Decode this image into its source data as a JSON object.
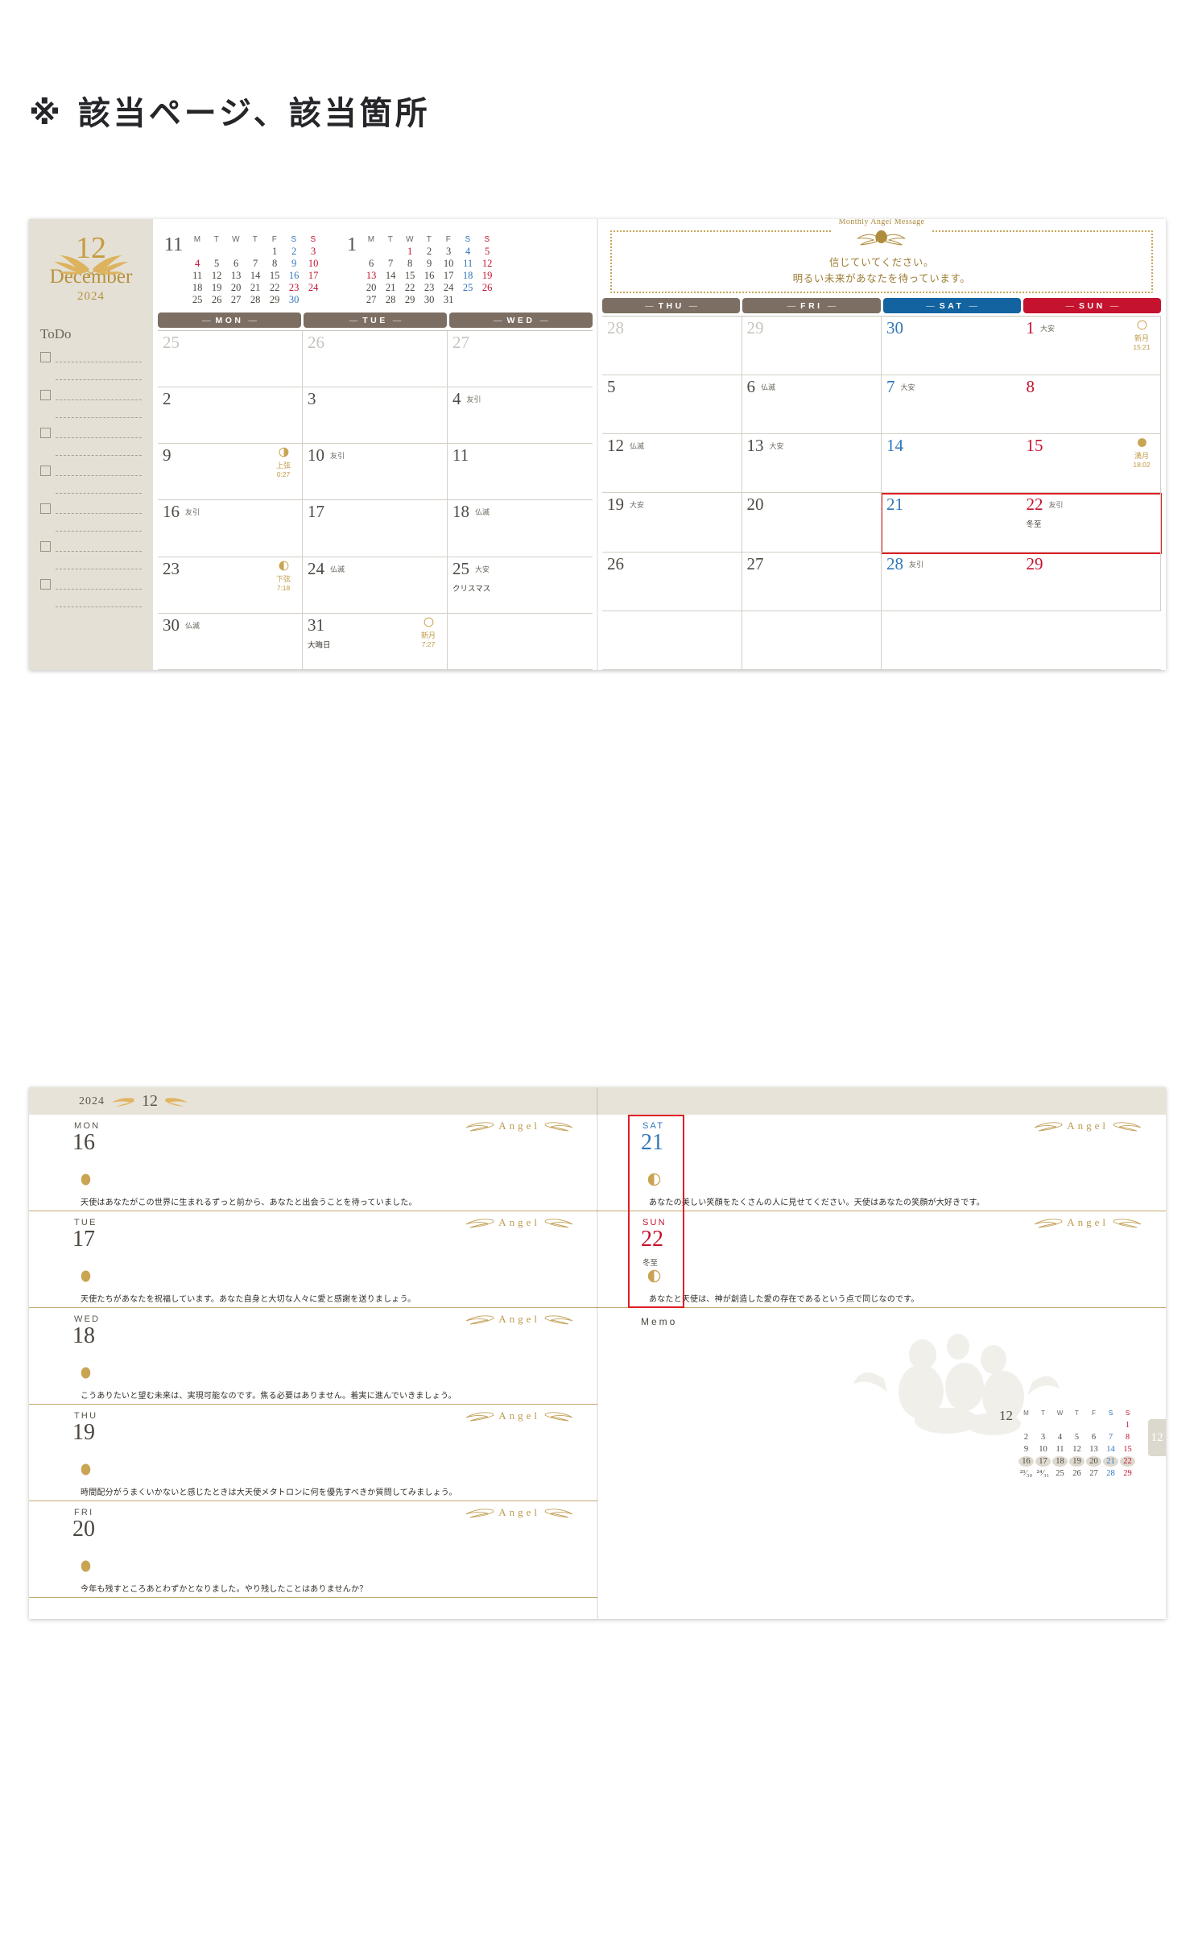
{
  "heading": "※ 該当ページ、該当箇所",
  "monthly": {
    "badge": {
      "month_number": "12",
      "month_name": "December",
      "year": "2024"
    },
    "todo_label": "ToDo",
    "todo_rows": 7,
    "mini_calendars": [
      {
        "label": "11",
        "weekdays": [
          "M",
          "T",
          "W",
          "T",
          "F",
          "S",
          "S"
        ],
        "weeks": [
          [
            "",
            "",
            "",
            "",
            "1",
            "2",
            "3"
          ],
          [
            "4",
            "5",
            "6",
            "7",
            "8",
            "9",
            "10"
          ],
          [
            "11",
            "12",
            "13",
            "14",
            "15",
            "16",
            "17"
          ],
          [
            "18",
            "19",
            "20",
            "21",
            "22",
            "23",
            "24"
          ],
          [
            "25",
            "26",
            "27",
            "28",
            "29",
            "30",
            ""
          ]
        ],
        "holidays": [
          "4",
          "23",
          "24"
        ]
      },
      {
        "label": "1",
        "weekdays": [
          "M",
          "T",
          "W",
          "T",
          "F",
          "S",
          "S"
        ],
        "weeks": [
          [
            "",
            "",
            "1",
            "2",
            "3",
            "4",
            "5"
          ],
          [
            "6",
            "7",
            "8",
            "9",
            "10",
            "11",
            "12"
          ],
          [
            "13",
            "14",
            "15",
            "16",
            "17",
            "18",
            "19"
          ],
          [
            "20",
            "21",
            "22",
            "23",
            "24",
            "25",
            "26"
          ],
          [
            "27",
            "28",
            "29",
            "30",
            "31",
            "",
            ""
          ]
        ],
        "holidays": [
          "1",
          "13"
        ]
      }
    ],
    "day_headers_left": [
      "MON",
      "TUE",
      "WED"
    ],
    "day_headers_right": [
      "THU",
      "FRI",
      "SAT",
      "SUN"
    ],
    "angel_message": {
      "title": "Monthly Angel Message",
      "line1": "信じていてください。",
      "line2": "明るい未来があなたを待っています。"
    },
    "cells_left": [
      {
        "num": "25",
        "prev": true
      },
      {
        "num": "26",
        "prev": true
      },
      {
        "num": "27",
        "prev": true
      },
      {
        "num": "2"
      },
      {
        "num": "3"
      },
      {
        "num": "4",
        "roku": "友引"
      },
      {
        "num": "9",
        "moon": "waxing",
        "moon_name": "上弦",
        "moon_time": "0:27"
      },
      {
        "num": "10",
        "roku": "友引"
      },
      {
        "num": "11"
      },
      {
        "num": "16",
        "roku": "友引"
      },
      {
        "num": "17"
      },
      {
        "num": "18",
        "roku": "仏滅"
      },
      {
        "num": "23",
        "moon": "waning",
        "moon_name": "下弦",
        "moon_time": "7:18"
      },
      {
        "num": "24",
        "roku": "仏滅"
      },
      {
        "num": "25",
        "roku": "大安",
        "ev": "クリスマス"
      },
      {
        "num": "30",
        "roku": "仏滅"
      },
      {
        "num": "31",
        "ev": "大晦日",
        "moon": "new",
        "moon_name": "新月",
        "moon_time": "7:27"
      },
      {
        "num": ""
      }
    ],
    "cells_right": [
      {
        "num": "28",
        "prev": true
      },
      {
        "num": "29",
        "prev": true
      },
      {
        "num": "30",
        "prev": true,
        "kind": "sat"
      },
      {
        "num": "1",
        "kind": "sun",
        "roku": "大安",
        "moon": "new",
        "moon_name": "新月",
        "moon_time": "15:21"
      },
      {
        "num": "5"
      },
      {
        "num": "6",
        "roku": "仏滅"
      },
      {
        "num": "7",
        "kind": "sat",
        "roku": "大安"
      },
      {
        "num": "8",
        "kind": "sun"
      },
      {
        "num": "12",
        "roku": "仏滅"
      },
      {
        "num": "13",
        "roku": "大安"
      },
      {
        "num": "14",
        "kind": "sat"
      },
      {
        "num": "15",
        "kind": "sun",
        "moon": "full",
        "moon_name": "満月",
        "moon_time": "18:02"
      },
      {
        "num": "19",
        "roku": "大安"
      },
      {
        "num": "20"
      },
      {
        "num": "21",
        "kind": "sat"
      },
      {
        "num": "22",
        "kind": "sun",
        "roku": "友引",
        "ev": "冬至"
      },
      {
        "num": "26"
      },
      {
        "num": "27"
      },
      {
        "num": "28",
        "kind": "sat",
        "roku": "友引"
      },
      {
        "num": "29",
        "kind": "sun"
      },
      {
        "num": ""
      },
      {
        "num": ""
      },
      {
        "num": ""
      },
      {
        "num": ""
      }
    ]
  },
  "weekly": {
    "header": {
      "year": "2024",
      "month": "12"
    },
    "angel_label": "Angel",
    "memo_label": "Memo",
    "days_left": [
      {
        "dow": "MON",
        "num": "16",
        "moon": "waxing-gibbous",
        "msg": "天使はあなたがこの世界に生まれるずっと前から、あなたと出会うことを待っていました。"
      },
      {
        "dow": "TUE",
        "num": "17",
        "moon": "waxing-gibbous",
        "msg": "天使たちがあなたを祝福しています。あなた自身と大切な人々に愛と感謝を送りましょう。"
      },
      {
        "dow": "WED",
        "num": "18",
        "moon": "waning-gibbous",
        "msg": "こうありたいと望む未来は、実現可能なのです。焦る必要はありません。着実に進んでいきましょう。"
      },
      {
        "dow": "THU",
        "num": "19",
        "moon": "waning-gibbous",
        "msg": "時間配分がうまくいかないと感じたときは大天使メタトロンに何を優先すべきか質問してみましょう。"
      },
      {
        "dow": "FRI",
        "num": "20",
        "moon": "waning-gibbous",
        "msg": "今年も残すところあとわずかとなりました。やり残したことはありませんか？"
      }
    ],
    "days_right": [
      {
        "dow": "SAT",
        "num": "21",
        "kind": "sat",
        "moon": "last-quarter",
        "msg": "あなたの美しい笑顔をたくさんの人に見せてください。天使はあなたの笑顔が大好きです。"
      },
      {
        "dow": "SUN",
        "num": "22",
        "kind": "sun",
        "sub": "冬至",
        "moon": "last-quarter",
        "msg": "あなたと天使は、神が創造した愛の存在であるという点で同じなのです。"
      }
    ],
    "mini_calendar": {
      "label": "12",
      "weekdays": [
        "M",
        "T",
        "W",
        "T",
        "F",
        "S",
        "S"
      ],
      "weeks": [
        [
          "",
          "",
          "",
          "",
          "",
          "",
          "1"
        ],
        [
          "2",
          "3",
          "4",
          "5",
          "6",
          "7",
          "8"
        ],
        [
          "9",
          "10",
          "11",
          "12",
          "13",
          "14",
          "15"
        ],
        [
          "16",
          "17",
          "18",
          "19",
          "20",
          "21",
          "22"
        ],
        [
          "²³⁄₃₀",
          "²⁴⁄₃₁",
          "25",
          "26",
          "27",
          "28",
          "29"
        ]
      ],
      "current_week": [
        "16",
        "17",
        "18",
        "19",
        "20",
        "21",
        "22"
      ]
    },
    "thumb_tab": "12"
  },
  "colors": {
    "sat": "#1a5f9e",
    "sun": "#c4122f",
    "gold": "#c09a45",
    "brown": "#7c6e63",
    "highlight": "#e01f26",
    "sidebar_bg": "#e4e0d6"
  }
}
